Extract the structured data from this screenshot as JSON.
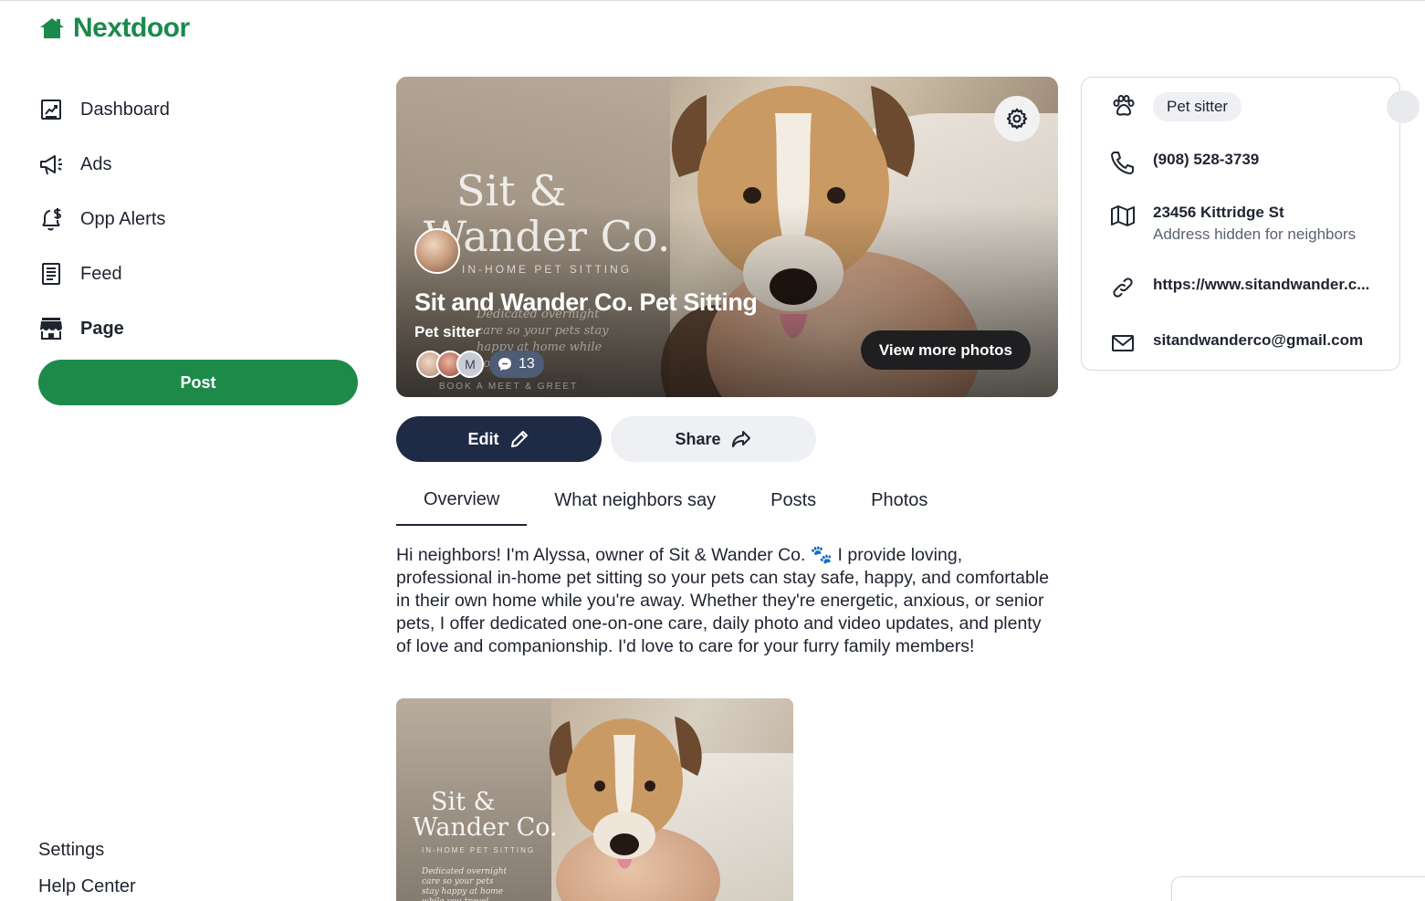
{
  "app": {
    "name": "Nextdoor",
    "brand_color": "#1a8a4c"
  },
  "sidebar": {
    "items": [
      {
        "label": "Dashboard",
        "icon": "dashboard-icon"
      },
      {
        "label": "Ads",
        "icon": "megaphone-icon"
      },
      {
        "label": "Opp Alerts",
        "icon": "bell-dollar-icon"
      },
      {
        "label": "Feed",
        "icon": "feed-icon"
      },
      {
        "label": "Page",
        "icon": "storefront-icon",
        "active": true
      }
    ],
    "post_label": "Post",
    "settings_label": "Settings",
    "help_label": "Help Center"
  },
  "hero": {
    "brand_line1": "Sit &",
    "brand_line2": "Wander Co.",
    "brand_sub": "IN-HOME PET SITTING",
    "brand_tag": "Dedicated overnight care so your pets stay happy at home while you travel.",
    "brand_book": "BOOK A MEET & GREET",
    "business_name": "Sit and Wander Co. Pet Sitting",
    "category": "Pet sitter",
    "face_initial": "M",
    "comment_count": "13",
    "more_photos_label": "View more photos"
  },
  "actions": {
    "edit_label": "Edit",
    "share_label": "Share"
  },
  "tabs": [
    {
      "label": "Overview",
      "active": true
    },
    {
      "label": "What neighbors say"
    },
    {
      "label": "Posts"
    },
    {
      "label": "Photos"
    }
  ],
  "about": "Hi neighbors! I'm Alyssa, owner of Sit & Wander Co. 🐾 I provide loving, professional in-home pet sitting so your pets can stay safe, happy, and comfortable in their own home while you're away. Whether they're energetic, anxious, or senior pets, I offer dedicated one-on-one care, daily photo and video updates, and plenty of love and companionship. I'd love to care for your furry family members!",
  "thumbnail": {
    "brand_line1": "Sit &",
    "brand_line2": "Wander Co.",
    "brand_sub": "IN-HOME PET SITTING",
    "brand_tag": "Dedicated overnight care so your pets stay happy at home while you travel."
  },
  "info": {
    "category": "Pet sitter",
    "phone": "(908) 528-3739",
    "address": "23456 Kittridge St",
    "address_note": "Address hidden for neighbors",
    "website": "https://www.sitandwander.c...",
    "email": "sitandwanderco@gmail.com"
  }
}
